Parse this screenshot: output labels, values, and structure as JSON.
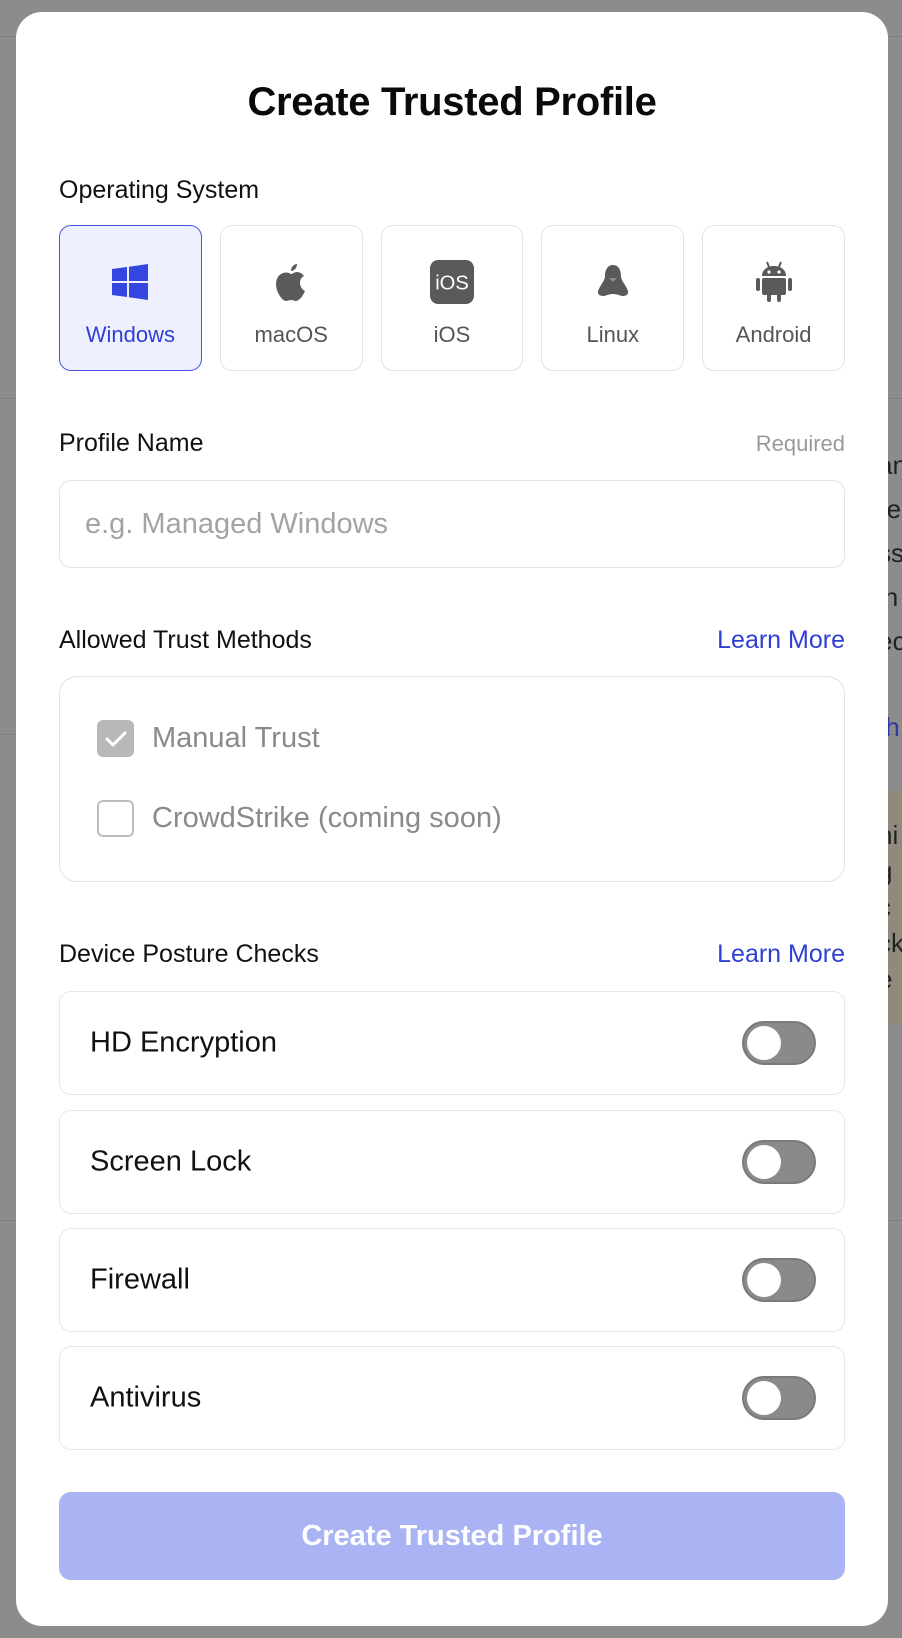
{
  "background": {
    "fragments": [
      ":",
      "an",
      "re",
      "ss",
      "in",
      "ec",
      "th",
      "hi",
      "g",
      "c",
      "ck",
      "e"
    ]
  },
  "modal": {
    "title": "Create Trusted Profile"
  },
  "os_section": {
    "label": "Operating System",
    "options": [
      {
        "label": "Windows",
        "icon": "windows-icon",
        "selected": true
      },
      {
        "label": "macOS",
        "icon": "apple-icon",
        "selected": false
      },
      {
        "label": "iOS",
        "icon": "ios-icon",
        "selected": false
      },
      {
        "label": "Linux",
        "icon": "linux-icon",
        "selected": false
      },
      {
        "label": "Android",
        "icon": "android-icon",
        "selected": false
      }
    ],
    "ios_badge_text": "iOS"
  },
  "profile_name": {
    "label": "Profile Name",
    "required_text": "Required",
    "placeholder": "e.g. Managed Windows",
    "value": ""
  },
  "trust_methods": {
    "label": "Allowed Trust Methods",
    "learn_more": "Learn More",
    "options": [
      {
        "label": "Manual Trust",
        "checked": true
      },
      {
        "label": "CrowdStrike (coming soon)",
        "checked": false
      }
    ]
  },
  "posture_checks": {
    "label": "Device Posture Checks",
    "learn_more": "Learn More",
    "items": [
      {
        "label": "HD Encryption",
        "enabled": false
      },
      {
        "label": "Screen Lock",
        "enabled": false
      },
      {
        "label": "Firewall",
        "enabled": false
      },
      {
        "label": "Antivirus",
        "enabled": false
      }
    ]
  },
  "submit": {
    "label": "Create Trusted Profile"
  },
  "colors": {
    "accent": "#2e3fd4",
    "selected_bg": "#eef0fd",
    "disabled_button": "#aab3f3",
    "toggle_off": "#8a8a8a"
  }
}
